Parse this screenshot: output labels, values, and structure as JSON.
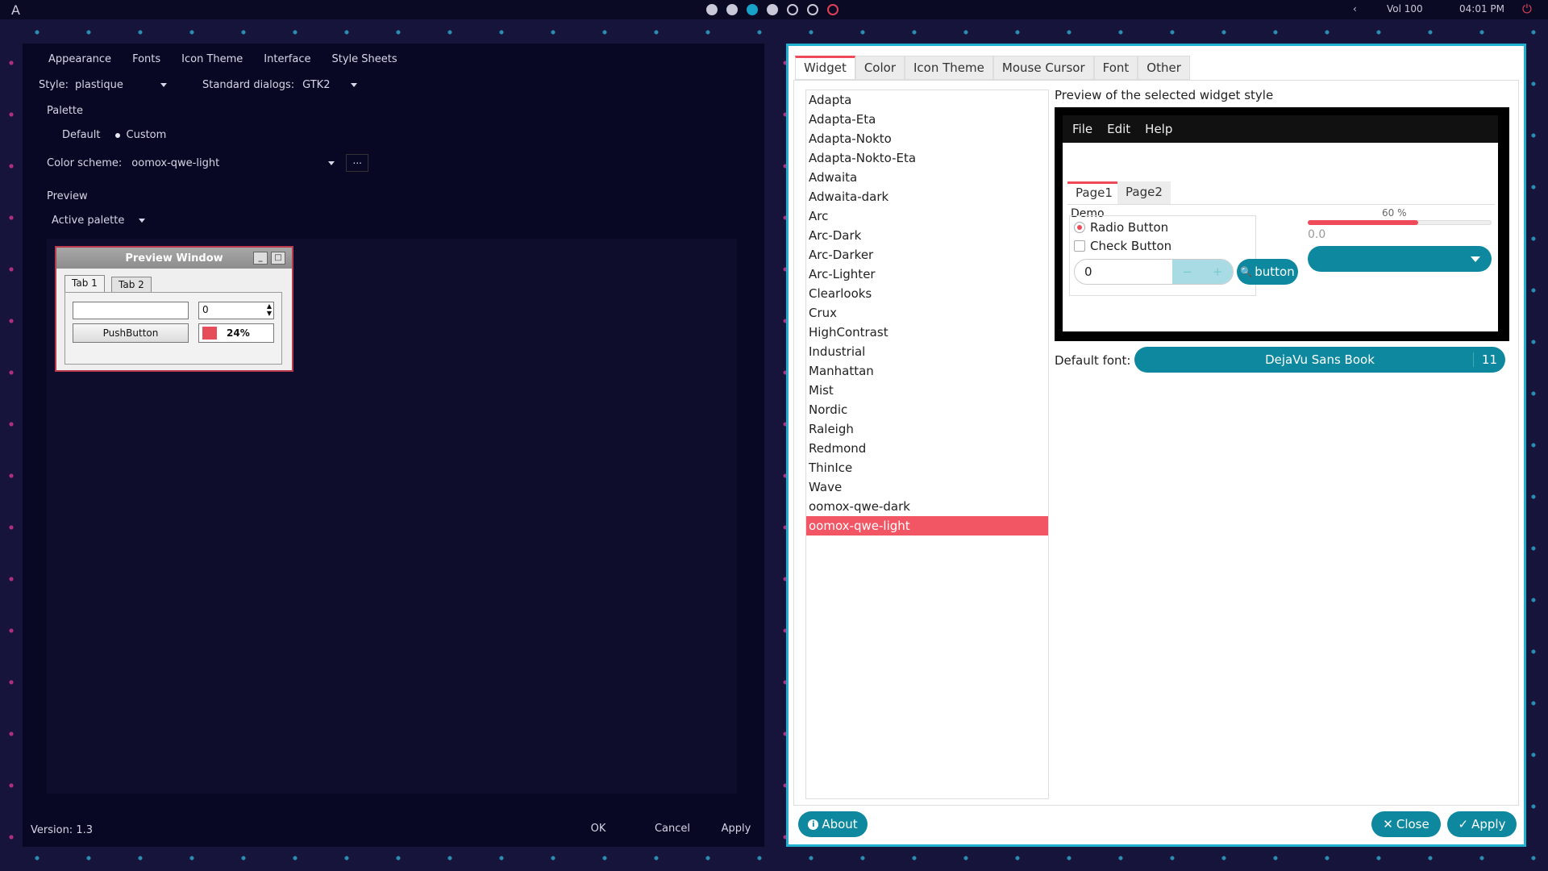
{
  "topbar": {
    "logo": "A",
    "workspaces": [
      "filled",
      "filled",
      "active",
      "filled",
      "empty",
      "empty",
      "power"
    ],
    "prev_arrow": "‹",
    "volume": "Vol 100",
    "clock": "04:01 PM"
  },
  "qt5ct": {
    "tabs": [
      "Appearance",
      "Fonts",
      "Icon Theme",
      "Interface",
      "Style Sheets"
    ],
    "style_label": "Style:",
    "style_value": "plastique",
    "dialogs_label": "Standard dialogs:",
    "dialogs_value": "GTK2",
    "palette_title": "Palette",
    "palette_default": "Default",
    "palette_custom": "Custom",
    "color_scheme_label": "Color scheme:",
    "color_scheme_value": "oomox-qwe-light",
    "more_button": "...",
    "preview_title": "Preview",
    "preview_palette": "Active palette",
    "preview_window": {
      "title": "Preview Window",
      "tab1": "Tab 1",
      "tab2": "Tab 2",
      "spin_value": "0",
      "push_button": "PushButton",
      "progress": "24%"
    },
    "version": "Version: 1.3",
    "buttons": {
      "ok": "OK",
      "cancel": "Cancel",
      "apply": "Apply"
    }
  },
  "gtk": {
    "tabs": [
      "Widget",
      "Color",
      "Icon Theme",
      "Mouse Cursor",
      "Font",
      "Other"
    ],
    "themes": [
      "Adapta",
      "Adapta-Eta",
      "Adapta-Nokto",
      "Adapta-Nokto-Eta",
      "Adwaita",
      "Adwaita-dark",
      "Arc",
      "Arc-Dark",
      "Arc-Darker",
      "Arc-Lighter",
      "Clearlooks",
      "Crux",
      "HighContrast",
      "Industrial",
      "Manhattan",
      "Mist",
      "Nordic",
      "Raleigh",
      "Redmond",
      "ThinIce",
      "Wave",
      "oomox-qwe-dark",
      "oomox-qwe-light"
    ],
    "selected_theme": "oomox-qwe-light",
    "preview_label": "Preview of the selected widget style",
    "demo": {
      "menu": [
        "File",
        "Edit",
        "Help"
      ],
      "page1": "Page1",
      "page2": "Page2",
      "frame_label": "Demo",
      "radio": "Radio Button",
      "check": "Check Button",
      "spin_value": "0",
      "button": "button",
      "progress_text": "60 %",
      "progress_value": 0.6,
      "scale_value": "0.0"
    },
    "default_font_label": "Default font:",
    "font_name": "DejaVu Sans Book",
    "font_size": "11",
    "about": "About",
    "close": "Close",
    "apply": "Apply"
  },
  "colors": {
    "accent": "#ef4a5a",
    "teal": "#0e889f",
    "border": "#1fb1cf"
  }
}
